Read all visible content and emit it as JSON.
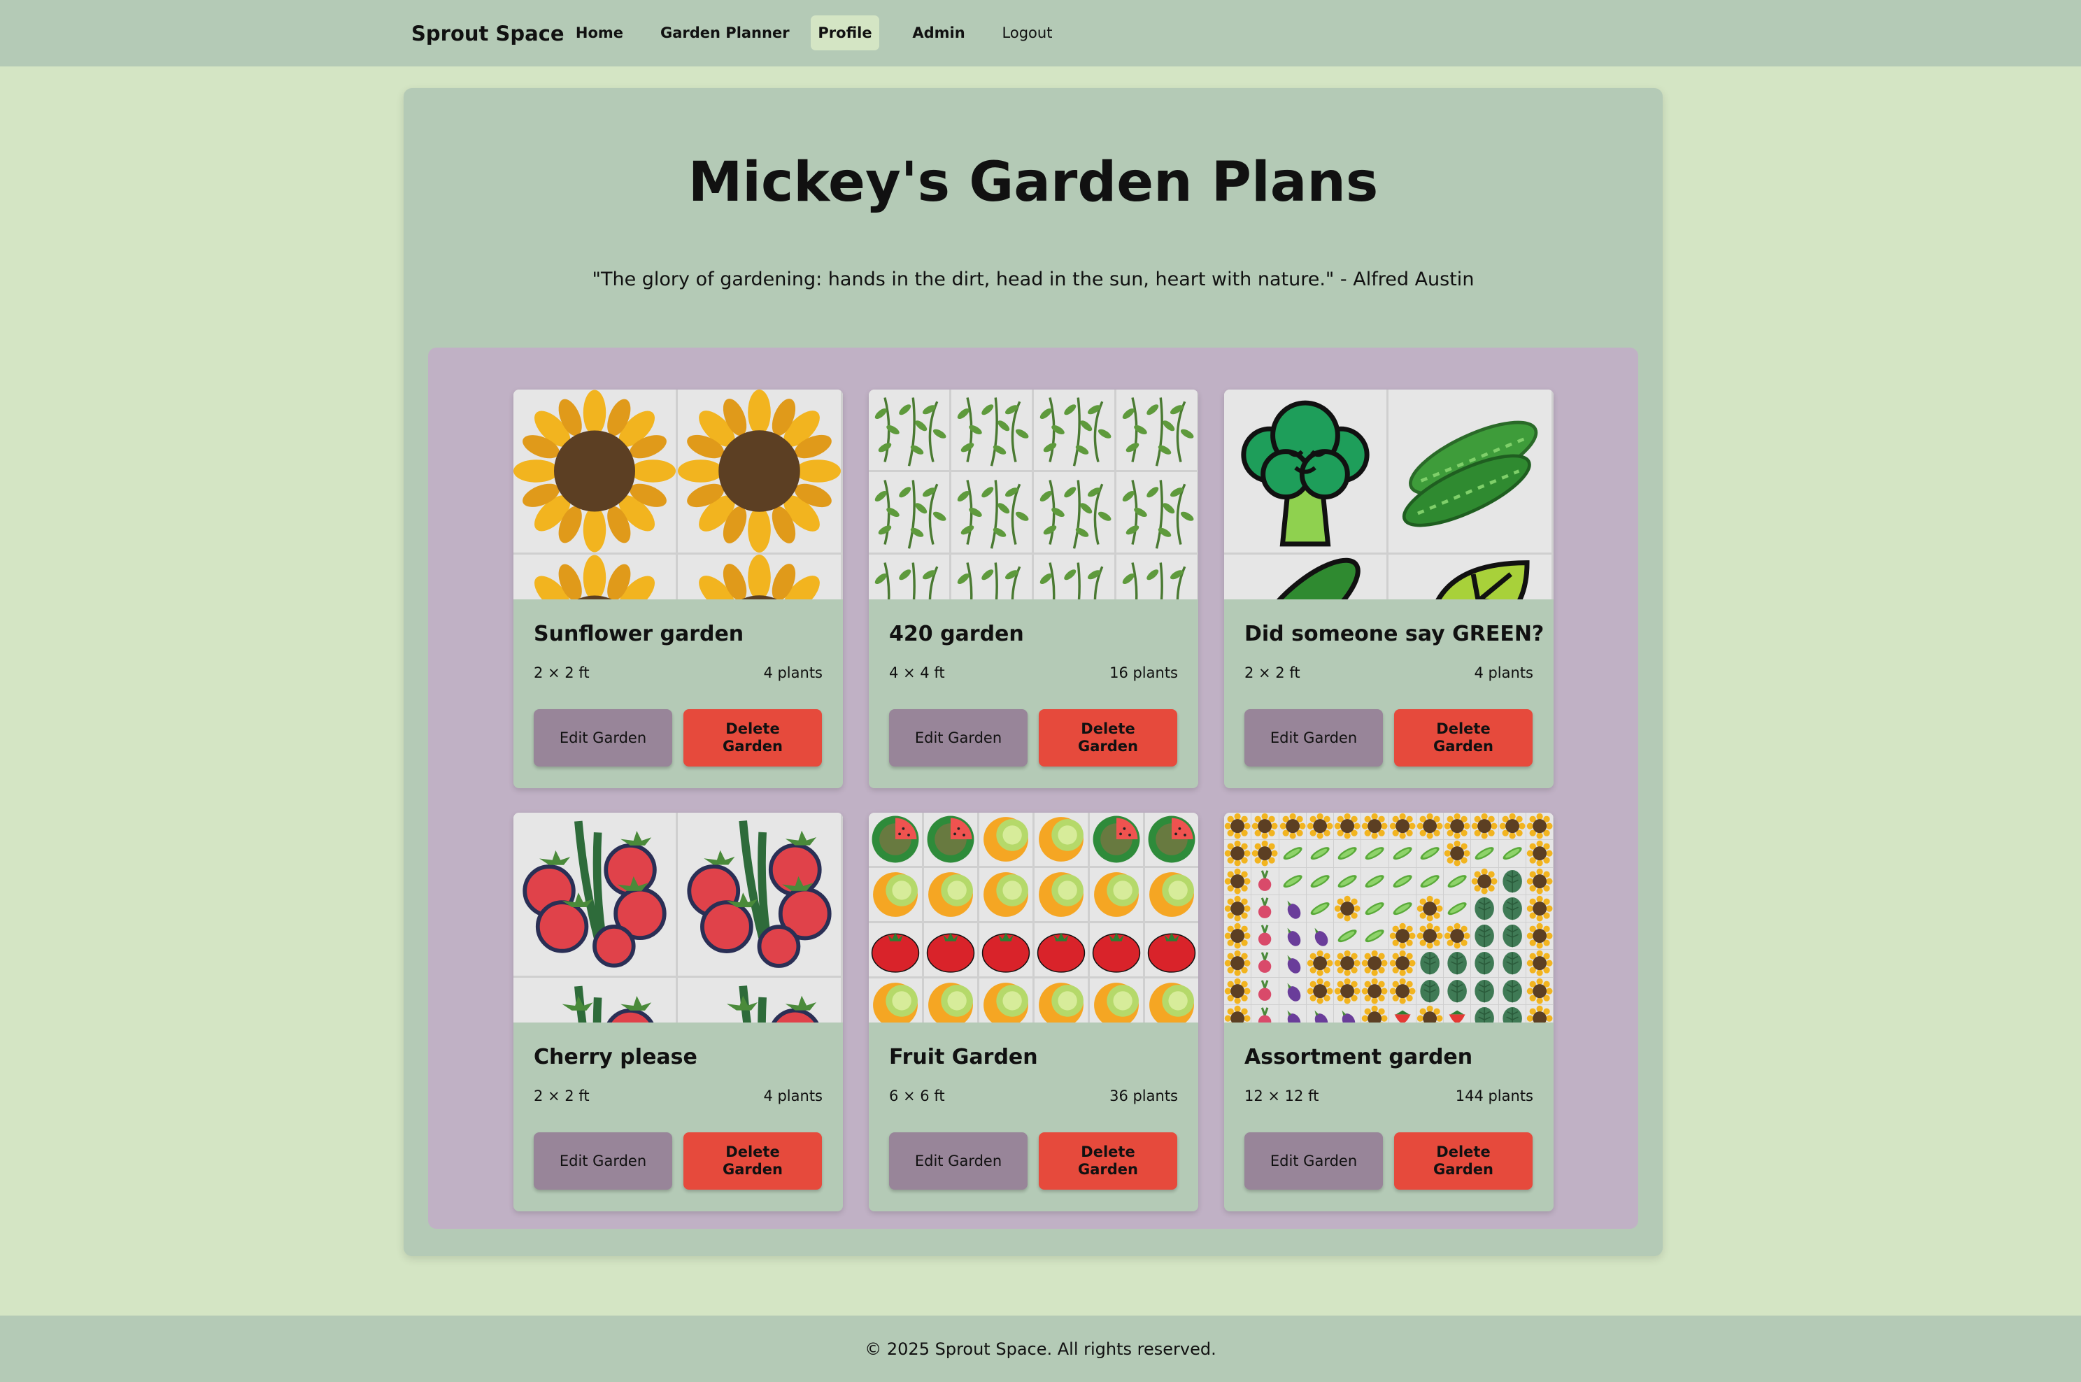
{
  "nav": {
    "brand": "Sprout Space",
    "items": [
      {
        "label": "Home"
      },
      {
        "label": "Garden Planner"
      },
      {
        "label": "Profile"
      },
      {
        "label": "Admin"
      },
      {
        "label": "Logout"
      }
    ]
  },
  "page": {
    "title": "Mickey's Garden Plans",
    "quote": "\"The glory of gardening: hands in the dirt, head in the sun, heart with nature.\" - Alfred Austin"
  },
  "gardens": [
    {
      "name": "Sunflower garden",
      "size": "2 × 2 ft",
      "plants": "4 plants",
      "edit_label": "Edit Garden",
      "delete_label": "Delete Garden",
      "thumb": "sunflower-grid"
    },
    {
      "name": "420 garden",
      "size": "4 × 4 ft",
      "plants": "16 plants",
      "edit_label": "Edit Garden",
      "delete_label": "Delete Garden",
      "thumb": "herb-grid"
    },
    {
      "name": "Did someone say GREEN?",
      "size": "2 × 2 ft",
      "plants": "4 plants",
      "edit_label": "Edit Garden",
      "delete_label": "Delete Garden",
      "thumb": "broccoli-cucumber-leaf-grid"
    },
    {
      "name": "Cherry please",
      "size": "2 × 2 ft",
      "plants": "4 plants",
      "edit_label": "Edit Garden",
      "delete_label": "Delete Garden",
      "thumb": "cherry-tomato-grid"
    },
    {
      "name": "Fruit Garden",
      "size": "6 × 6 ft",
      "plants": "36 plants",
      "edit_label": "Edit Garden",
      "delete_label": "Delete Garden",
      "thumb": "watermelon-melon-tomato-grid"
    },
    {
      "name": "Assortment garden",
      "size": "12 × 12 ft",
      "plants": "144 plants",
      "edit_label": "Edit Garden",
      "delete_label": "Delete Garden",
      "thumb": "mixed-plant-grid"
    }
  ],
  "footer": {
    "text": "© 2025 Sprout Space. All rights reserved."
  }
}
